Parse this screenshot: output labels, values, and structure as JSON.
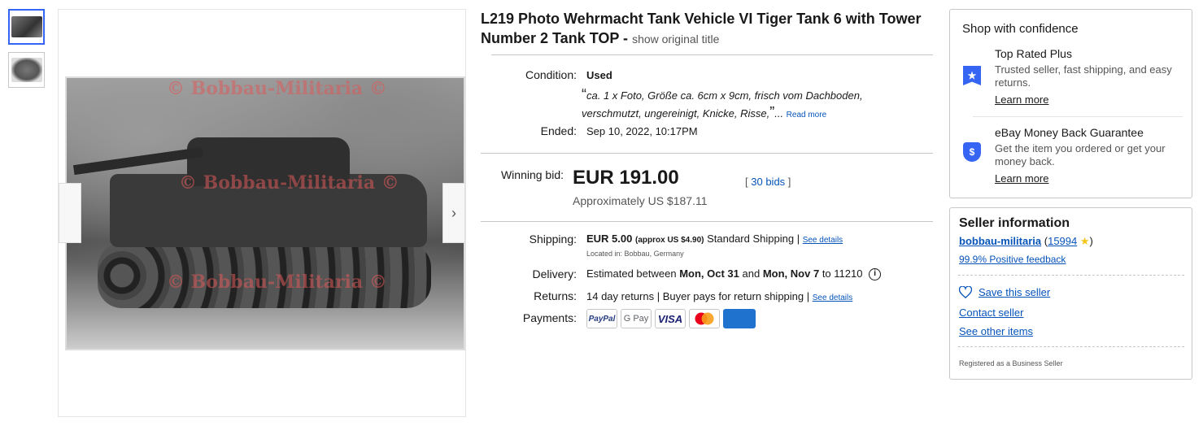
{
  "gallery": {
    "thumbnails": [
      "thumbnail-1",
      "thumbnail-2"
    ],
    "watermark": "© Bobbau-Militaria ©"
  },
  "listing": {
    "title": "L219 Photo Wehrmacht Tank Vehicle VI Tiger Tank 6 with Tower Number 2 Tank TOP -",
    "show_original": "show original title",
    "condition_label": "Condition:",
    "condition_value": "Used",
    "condition_note": "ca. 1 x Foto, Größe ca. 6cm x 9cm, frisch vom Dachboden, verschmutzt, ungereinigt, Knicke, Risse,",
    "read_more": "Read more",
    "ended_label": "Ended:",
    "ended_value": "Sep 10, 2022, 10:17PM",
    "winning_bid_label": "Winning bid:",
    "winning_bid": "EUR 191.00",
    "approx": "Approximately US $187.11",
    "bids_open": "[",
    "bids": "30 bids",
    "bids_close": "]",
    "shipping_label": "Shipping:",
    "shipping_price": "EUR 5.00",
    "shipping_approx": "(approx US $4.90)",
    "shipping_method": "Standard Shipping |",
    "see_details": "See details",
    "located": "Located in: Bobbau, Germany",
    "delivery_label": "Delivery:",
    "delivery_prefix": "Estimated between",
    "delivery_from": "Mon, Oct 31",
    "delivery_and": "and",
    "delivery_to": "Mon, Nov 7",
    "delivery_zip": "to 11210",
    "returns_label": "Returns:",
    "returns_value": "14 day returns | Buyer pays for return shipping |",
    "returns_details": "See details",
    "payments_label": "Payments:",
    "payments": [
      "PayPal",
      "G Pay",
      "VISA",
      "Mastercard",
      "AMEX"
    ]
  },
  "confidence": {
    "heading": "Shop with confidence",
    "items": [
      {
        "title": "Top Rated Plus",
        "text": "Trusted seller, fast shipping, and easy returns.",
        "link": "Learn more",
        "icon": "top-rated-icon"
      },
      {
        "title": "eBay Money Back Guarantee",
        "text": "Get the item you ordered or get your money back.",
        "link": "Learn more",
        "icon": "money-back-icon"
      }
    ]
  },
  "seller": {
    "heading": "Seller information",
    "name": "bobbau-militaria",
    "paren_open": "(",
    "score": "15994",
    "paren_close": ")",
    "feedback": "99.9% Positive feedback",
    "save": "Save this seller",
    "contact": "Contact seller",
    "other": "See other items",
    "registered": "Registered as a Business Seller"
  },
  "colors": {
    "link": "#0654ba",
    "accent": "#3665f3",
    "border": "#c7c7c7"
  }
}
